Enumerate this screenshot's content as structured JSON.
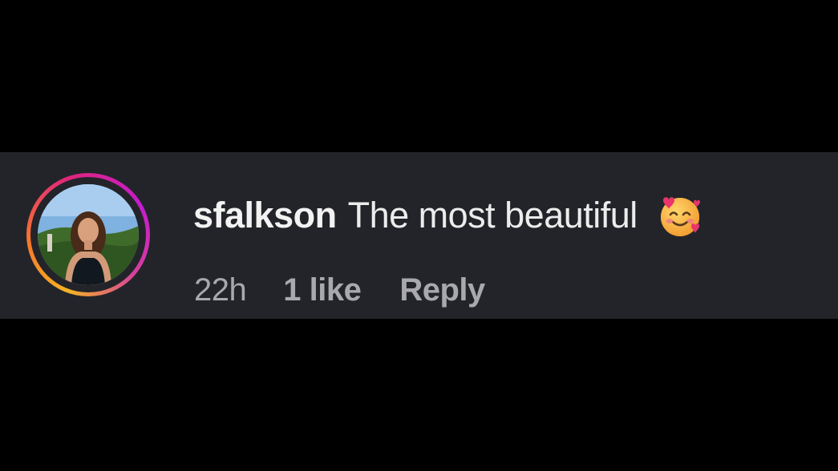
{
  "comment": {
    "username": "sfalkson",
    "text": "The most beautiful",
    "emoji_icon": "smiling-face-with-hearts-icon",
    "avatar_ring_colors": [
      "#f5b324",
      "#e0267a",
      "#c41bd0"
    ],
    "meta": {
      "time": "22h",
      "likes": "1 like",
      "reply_label": "Reply"
    }
  },
  "colors": {
    "page_background": "#000000",
    "comment_background": "#232429",
    "primary_text": "#ececec",
    "secondary_text": "#a8a8ad"
  }
}
